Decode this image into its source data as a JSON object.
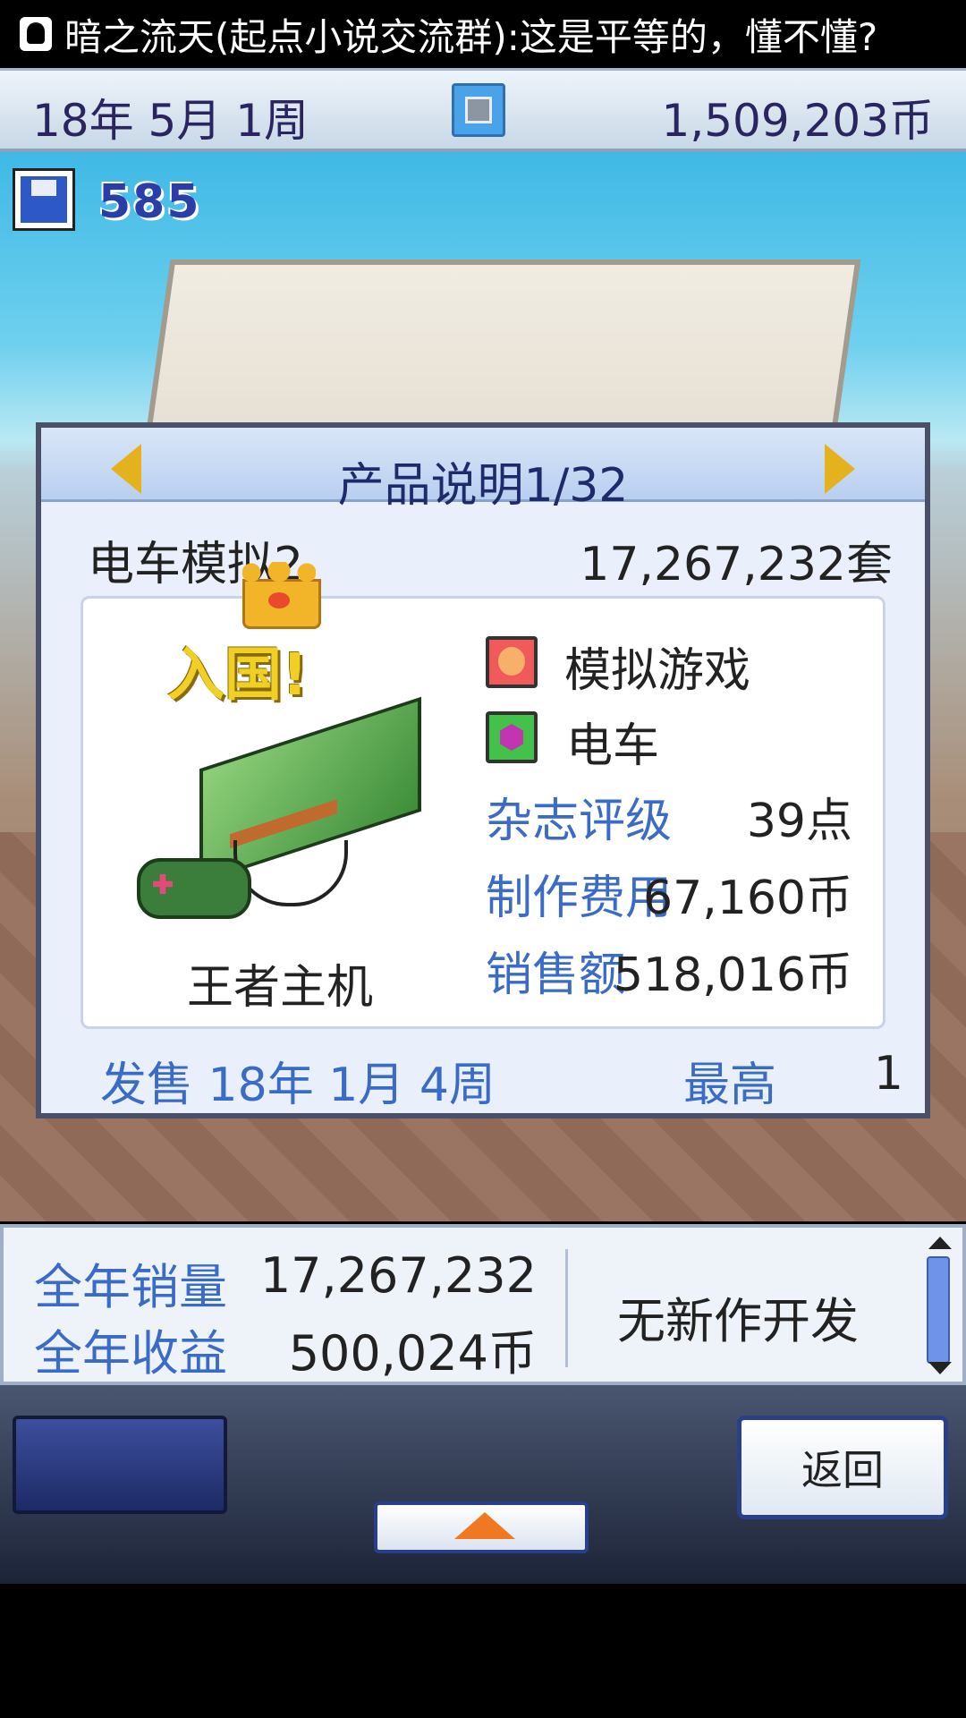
{
  "notification": {
    "text": "暗之流天(起点小说交流群):这是平等的，懂不懂?"
  },
  "topbar": {
    "date": "18年 5月 1周",
    "money": "1,509,203币"
  },
  "resources": {
    "research_points": "585"
  },
  "dialog": {
    "title": "产品说明1/32",
    "product_name": "电车模拟2",
    "product_sales": "17,267,232套",
    "hall_of_fame": "入国!",
    "platform": "王者主机",
    "genre": "模拟游戏",
    "type": "电车",
    "stats": [
      {
        "label": "杂志评级",
        "value": "39点"
      },
      {
        "label": "制作费用",
        "value": "67,160币"
      },
      {
        "label": "销售额",
        "value": "518,016币"
      }
    ],
    "release": "发售 18年 1月 4周",
    "best_label": "最高",
    "best_value": "1"
  },
  "info_panel": {
    "annual_sales_label": "全年销量",
    "annual_sales_value": "17,267,232",
    "annual_revenue_label": "全年收益",
    "annual_revenue_value": "500,024币",
    "status": "无新作开发"
  },
  "controls": {
    "back_label": "返回"
  },
  "colors": {
    "accent_blue": "#3a6bc6",
    "text_dark": "#222222",
    "gold": "#e4b21c"
  }
}
